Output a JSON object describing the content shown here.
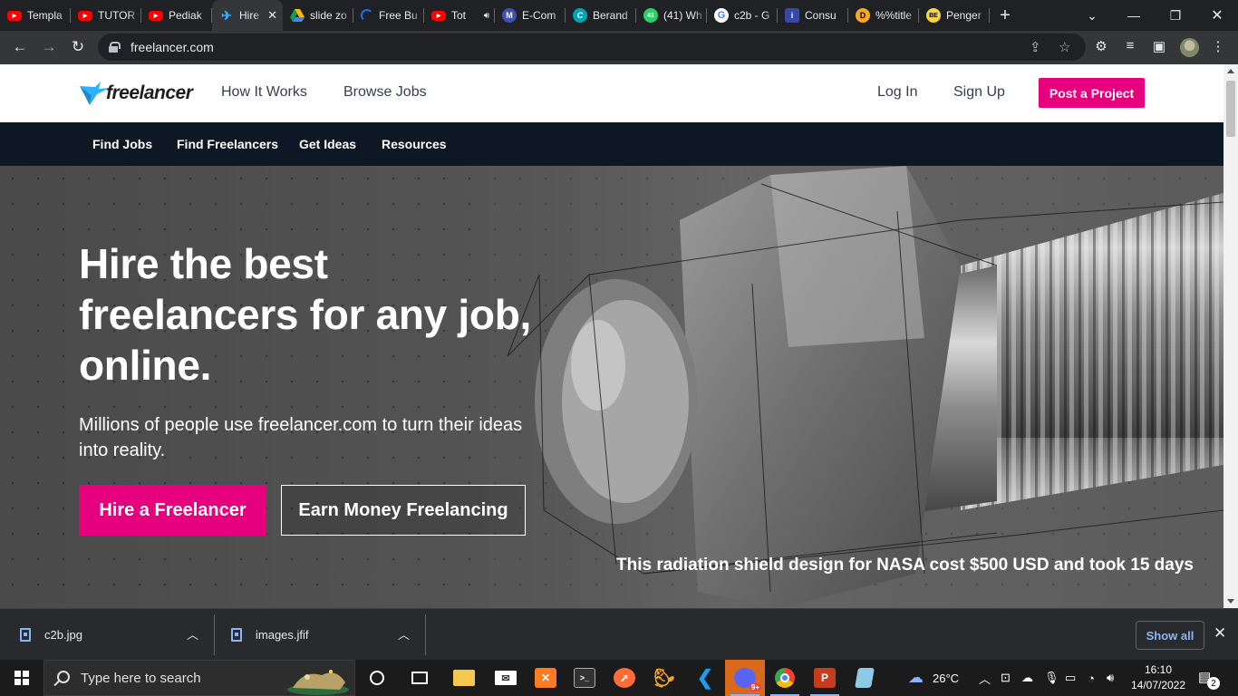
{
  "browser": {
    "tabs": [
      {
        "title": "Templa",
        "favicon": "youtube-icon",
        "color": "#ff0000"
      },
      {
        "title": "TUTOR",
        "favicon": "youtube-icon",
        "color": "#ff0000"
      },
      {
        "title": "Pediak",
        "favicon": "youtube-icon",
        "color": "#ff0000"
      },
      {
        "title": "Hire",
        "favicon": "freelancer-icon",
        "color": "#29b2fe",
        "active": true
      },
      {
        "title": "slide zo",
        "favicon": "google-drive-icon",
        "color": "#fbbc04"
      },
      {
        "title": "Free Bu",
        "favicon": "loading-icon",
        "color": "#1a73e8"
      },
      {
        "title": "Tot",
        "favicon": "youtube-icon",
        "color": "#ff0000"
      },
      {
        "title": "E-Com",
        "favicon": "m-icon",
        "color": "#3f51b5",
        "letter": "M"
      },
      {
        "title": "Berand",
        "favicon": "canva-icon",
        "color": "#00c4cc",
        "letter": "C"
      },
      {
        "title": "(41) Wh",
        "favicon": "whatsapp-icon",
        "color": "#25d366",
        "letter": "41"
      },
      {
        "title": "c2b - G",
        "favicon": "google-icon",
        "color": "#4285f4",
        "letter": "G"
      },
      {
        "title": "Consu",
        "favicon": "info-icon",
        "color": "#3949ab",
        "letter": "i"
      },
      {
        "title": "%%title",
        "favicon": "d-icon",
        "color": "#f9a825",
        "letter": "D"
      },
      {
        "title": "Penger",
        "favicon": "be-icon",
        "color": "#fdd835",
        "letter": "BE"
      }
    ],
    "url": "freelancer.com",
    "new_tab_label": "+"
  },
  "site": {
    "logo_text": "freelancer",
    "top_links": {
      "how_it_works": "How It Works",
      "browse_jobs": "Browse Jobs",
      "log_in": "Log In",
      "sign_up": "Sign Up"
    },
    "post_project": "Post a Project",
    "sub_nav": [
      "Find Jobs",
      "Find Freelancers",
      "Get Ideas",
      "Resources"
    ],
    "hero": {
      "title": "Hire the best freelancers for any job, online.",
      "subtitle": "Millions of people use freelancer.com to turn their ideas into reality.",
      "hire_button": "Hire a Freelancer",
      "earn_button": "Earn Money Freelancing",
      "caption": "This radiation shield design for NASA cost $500 USD and took 15 days"
    },
    "colors": {
      "brand_pink": "#e6007e",
      "subnav_bg": "#0e1724",
      "logo_blue": "#29b2fe"
    }
  },
  "downloads": {
    "items": [
      {
        "name": "c2b.jpg"
      },
      {
        "name": "images.jfif"
      }
    ],
    "show_all": "Show all"
  },
  "taskbar": {
    "search_placeholder": "Type here to search",
    "apps": [
      {
        "name": "cortana-icon"
      },
      {
        "name": "task-view-icon"
      },
      {
        "name": "file-explorer-icon"
      },
      {
        "name": "mail-icon"
      },
      {
        "name": "xampp-icon"
      },
      {
        "name": "terminal-icon"
      },
      {
        "name": "postman-icon"
      },
      {
        "name": "dbeaver-icon"
      },
      {
        "name": "vscode-icon"
      },
      {
        "name": "discord-icon",
        "badge": "9+"
      },
      {
        "name": "chrome-icon"
      },
      {
        "name": "powerpoint-icon"
      },
      {
        "name": "notepad-icon"
      }
    ],
    "weather": "26°C",
    "time": "16:10",
    "date": "14/07/2022",
    "notifications": "2"
  }
}
